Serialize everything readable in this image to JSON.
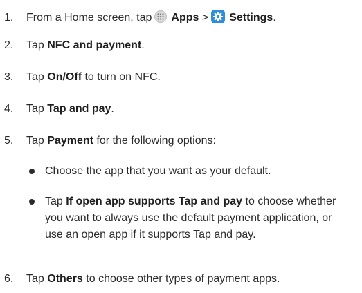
{
  "steps": [
    {
      "num": "1.",
      "t1": "From a Home screen, tap",
      "b1": "Apps",
      "sep": ">",
      "b2": "Settings",
      "end": ".",
      "apps_icon": "apps-grid-icon",
      "settings_icon": "gear-icon",
      "settings_icon_color": "#2f8ed8"
    },
    {
      "num": "2.",
      "t1": "Tap",
      "b1": "NFC and payment",
      "t2": "."
    },
    {
      "num": "3.",
      "t1": "Tap",
      "b1": "On/Off",
      "t2": "to turn on NFC."
    },
    {
      "num": "4.",
      "t1": "Tap",
      "b1": "Tap and pay",
      "t2": "."
    },
    {
      "num": "5.",
      "t1": "Tap",
      "b1": "Payment",
      "t2": "for the following options:"
    },
    {
      "num": "6.",
      "t1": "Tap",
      "b1": "Others",
      "t2": "to choose other types of payment apps."
    }
  ],
  "bullets": [
    {
      "text": "Choose the app that you want as your default."
    },
    {
      "pre": "Tap",
      "bold": "If open app supports Tap and pay",
      "post": "to choose whether you want to always use the default payment application, or use an open app if it supports Tap and pay."
    }
  ]
}
